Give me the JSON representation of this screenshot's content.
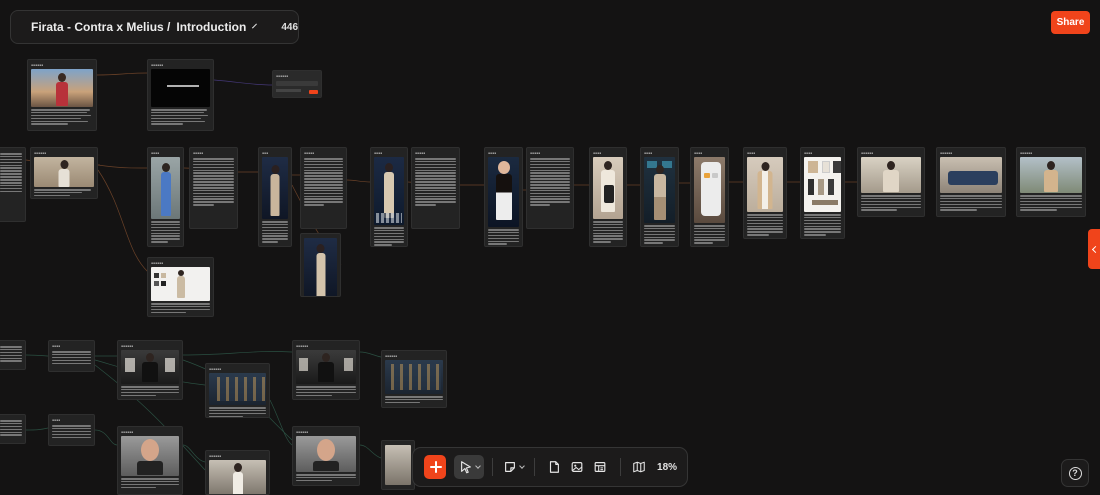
{
  "header": {
    "project": "Firata - Contra x Melius /",
    "page": "Introduction",
    "credits": "446",
    "share_label": "Share"
  },
  "toolbar": {
    "zoom": "18%"
  },
  "help_label": "?",
  "colors": {
    "accent": "#f0441b",
    "canvas_bg": "#141313",
    "node_bg": "#232323",
    "edge_orange": "#7a4a2c",
    "edge_green": "#2f5a4a",
    "edge_purple": "#4d3f8a"
  },
  "icons": [
    "menu-icon",
    "chevron-down-icon",
    "credits-icon",
    "plus-icon",
    "pointer-icon",
    "sticky-note-icon",
    "document-icon",
    "image-icon",
    "layout-icon",
    "map-icon",
    "help-icon",
    "chevron-left-icon"
  ]
}
